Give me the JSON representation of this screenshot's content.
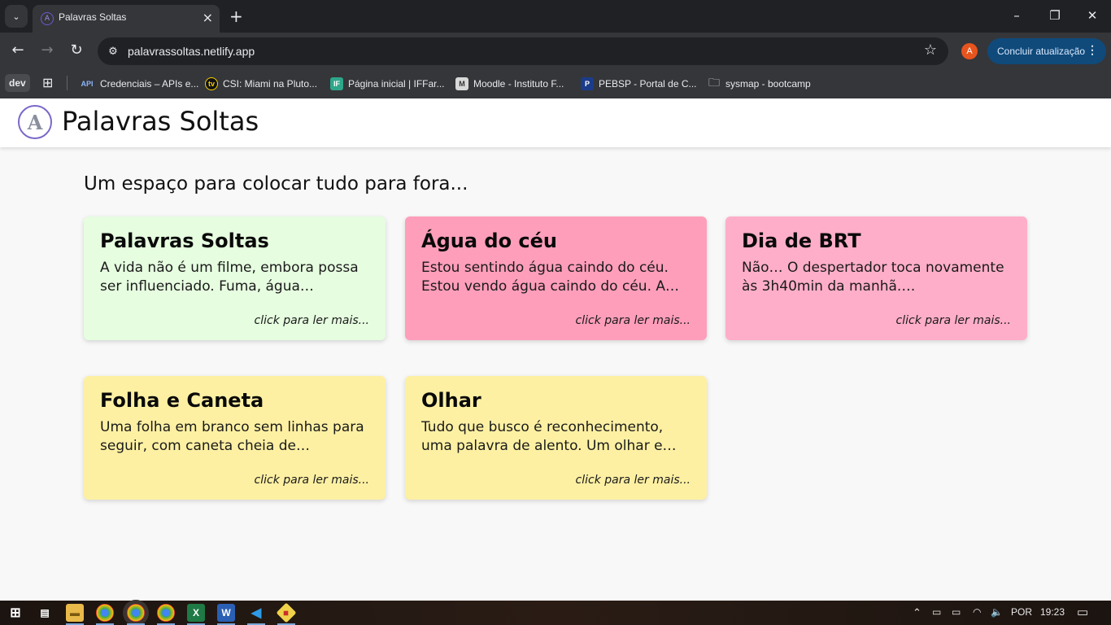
{
  "browser": {
    "tab_title": "Palavras Soltas",
    "url": "palavrassoltas.netlify.app",
    "profile_initial": "A",
    "update_label": "Concluir atualização",
    "bookmarks": [
      {
        "label": "dev"
      },
      {
        "label": "Credenciais – APIs e...",
        "icon": "API"
      },
      {
        "label": "CSI: Miami na Pluto...",
        "icon": "tv"
      },
      {
        "label": "Página inicial | IFFar...",
        "icon": "IF"
      },
      {
        "label": "Moodle - Instituto F...",
        "icon": "M"
      },
      {
        "label": "PEBSP - Portal de C...",
        "icon": "P"
      },
      {
        "label": "sysmap - bootcamp",
        "icon": "folder-icon"
      }
    ]
  },
  "site": {
    "logo_letter": "A",
    "title": "Palavras Soltas",
    "tagline": "Um espaço para colocar tudo para fora...",
    "cards": [
      {
        "title": "Palavras Soltas",
        "excerpt": "A vida não é um filme, embora possa ser influenciado. Fuma, água…",
        "more": "click para ler mais...",
        "color": "#e6fde0"
      },
      {
        "title": "Água do céu",
        "excerpt": "Estou sentindo água caindo do céu. Estou vendo água caindo do céu. A…",
        "more": "click para ler mais...",
        "color": "#fe9ebb"
      },
      {
        "title": "Dia de BRT",
        "excerpt": "Não… O despertador toca novamente às 3h40min da manhã.…",
        "more": "click para ler mais...",
        "color": "#ffaec9"
      },
      {
        "title": "Folha e Caneta",
        "excerpt": "Uma folha em branco sem linhas para seguir, com caneta cheia de…",
        "more": "click para ler mais...",
        "color": "#fdf0a3"
      },
      {
        "title": "Olhar",
        "excerpt": "Tudo que busco é reconhecimento, uma palavra de alento. Um olhar e…",
        "more": "click para ler mais...",
        "color": "#fdf0a3"
      }
    ]
  },
  "taskbar": {
    "language": "POR",
    "time": "19:23"
  }
}
